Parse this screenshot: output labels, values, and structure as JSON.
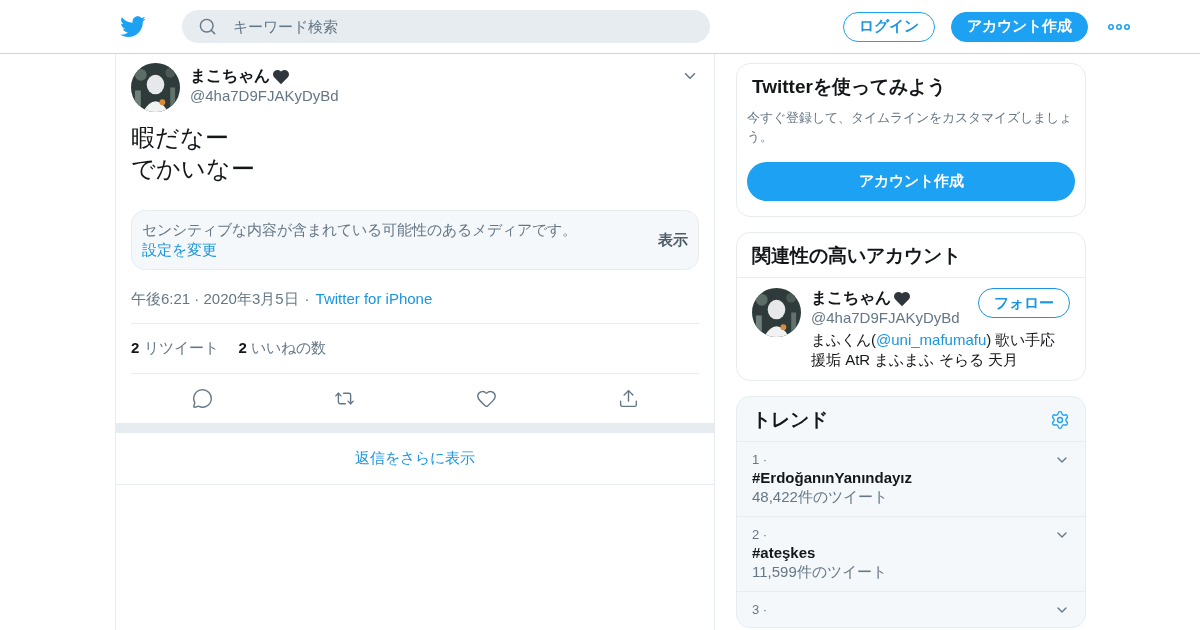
{
  "header": {
    "search": {
      "placeholder": "キーワード検索"
    },
    "buttons": [
      {
        "label": "ログイン",
        "kind": "outline"
      },
      {
        "label": "アカウント作成",
        "kind": "filled"
      }
    ]
  },
  "tweet": {
    "author": {
      "name": "まこちゃん",
      "handle": "@4ha7D9FJAKyDyBd"
    },
    "lines": [
      "暇だなー",
      "でかいなー"
    ],
    "sensitive": {
      "text": "センシティブな内容が含まれている可能性のあるメディアです。",
      "link": "設定を変更",
      "button": "表示"
    },
    "meta": {
      "time": "午後6:21 · 2020年3月5日",
      "separator": "·",
      "source": "Twitter for iPhone"
    },
    "stats": [
      {
        "count": "2",
        "label": "リツイート"
      },
      {
        "count": "2",
        "label": "いいねの数"
      }
    ],
    "actions": [
      {
        "kind": "reply"
      },
      {
        "kind": "retweet"
      },
      {
        "kind": "like"
      },
      {
        "kind": "share"
      }
    ],
    "more_replies": "返信をさらに表示"
  },
  "sidebar": {
    "signup": {
      "title": "Twitterを使ってみよう",
      "text": "今すぐ登録して、タイムラインをカスタマイズしましょう。",
      "button": "アカウント作成"
    },
    "related": {
      "title": "関連性の高いアカウント",
      "accounts": [
        {
          "name": "まこちゃん",
          "handle": "@4ha7D9FJAKyDyBd",
          "follow": "フォロー",
          "bio_before": "まふくん(",
          "bio_link": "@uni_mafumafu",
          "bio_after": ") 歌い手応援垢 AtR まふまふ そらる 天月"
        }
      ]
    },
    "trends": {
      "title": "トレンド",
      "items": [
        {
          "rank": "1 ·",
          "name": "#ErdoğanınYanındayız",
          "count": "48,422件のツイート"
        },
        {
          "rank": "2 ·",
          "name": "#ateşkes",
          "count": "11,599件のツイート"
        },
        {
          "rank": "3 ·"
        }
      ]
    }
  }
}
